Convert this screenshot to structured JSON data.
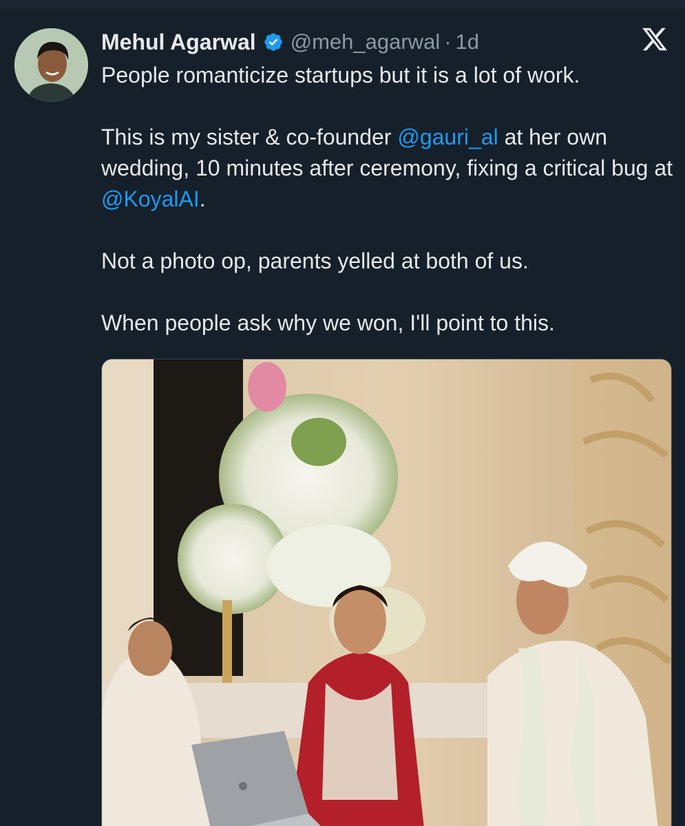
{
  "author": {
    "name": "Mehul Agarwal",
    "handle": "@meh_agarwal",
    "separator": "·",
    "time": "1d",
    "avatar_icon": "profile-avatar",
    "verified_icon": "verified-badge-icon"
  },
  "brand_icon": "x-logo-icon",
  "tweet": {
    "line1": "People romanticize startups but it is a lot of work.",
    "p2_a": "This is my sister & co-founder ",
    "p2_mention1": "@gauri_al",
    "p2_b": " at her own wedding, 10 minutes after ceremony, fixing a critical bug at ",
    "p2_mention2": "@KoyalAI",
    "p2_c": ".",
    "p3": "Not a photo op, parents yelled at both of us.",
    "p4": "When people ask why we won, I'll point to this."
  },
  "media": {
    "type": "photo"
  },
  "colors": {
    "background": "#15202b",
    "text": "#e7e9ea",
    "secondary_text": "#8b98a5",
    "link": "#1d9bf0",
    "verified": "#1d9bf0"
  }
}
